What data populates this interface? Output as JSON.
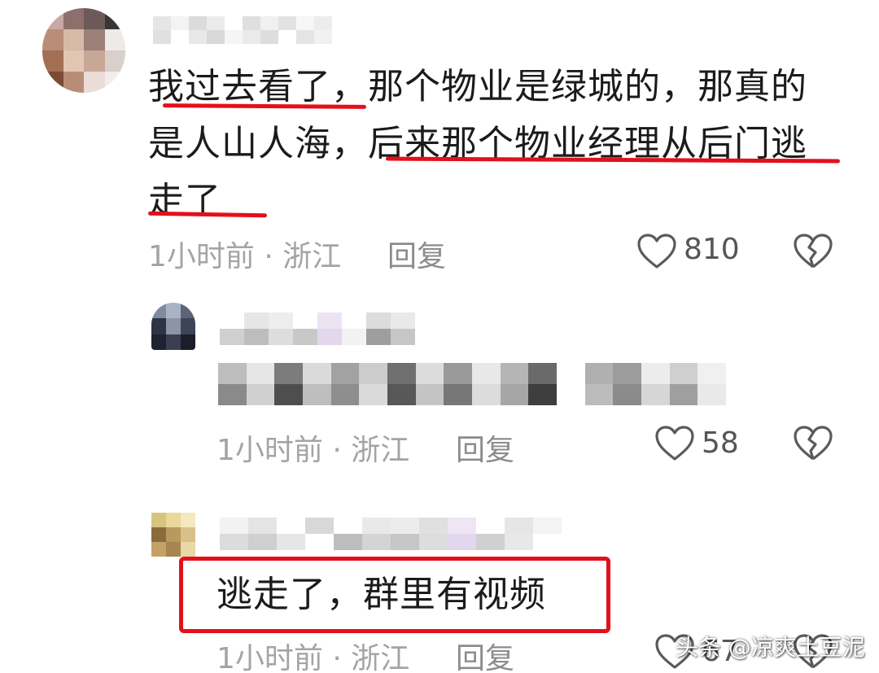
{
  "comments": [
    {
      "text_line1": "我过去看了，那个物业是绿城的，那真的",
      "text_line2": "是人山人海，后来那个物业经理从后门逃",
      "text_line3": "走了",
      "meta": "1小时前 · 浙江",
      "reply_label": "回复",
      "likes": "810"
    },
    {
      "meta": "1小时前 · 浙江",
      "reply_label": "回复",
      "likes": "58"
    },
    {
      "text": "逃走了，群里有视频",
      "meta": "1小时前 · 浙江",
      "reply_label": "回复",
      "likes": "67"
    }
  ],
  "watermark": "头条 @凉爽土豆泥",
  "icons": {
    "like": "heart-outline-icon",
    "dislike": "broken-heart-icon"
  },
  "colors": {
    "annotation_red": "#e3101c",
    "meta_gray": "#a4a4a4"
  }
}
